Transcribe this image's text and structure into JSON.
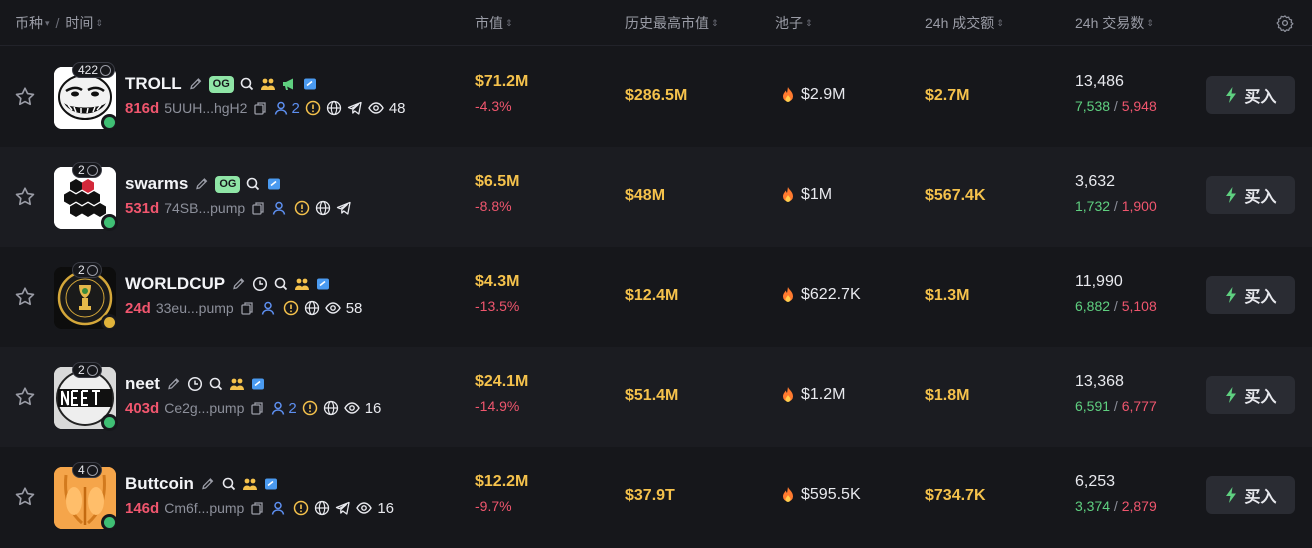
{
  "header": {
    "col_token": "币种",
    "col_time": "时间",
    "col_mcap": "市值",
    "col_ath": "历史最高市值",
    "col_pool": "池子",
    "col_vol": "24h 成交额",
    "col_txs": "24h 交易数"
  },
  "rows": [
    {
      "name": "TROLL",
      "holders_count": "422",
      "og": "OG",
      "age": "816d",
      "address": "5UUH...hgH2",
      "holders": "2",
      "watchers": "48",
      "market_cap": "$71.2M",
      "market_cap_change": "-4.3%",
      "ath": "$286.5M",
      "pool": "$2.9M",
      "volume": "$2.7M",
      "txs": "13,486",
      "buys": "7,538",
      "sells": "5,948",
      "buy_label": "买入",
      "avatar_color": "#ffffff"
    },
    {
      "name": "swarms",
      "holders_count": "2",
      "og": "OG",
      "age": "531d",
      "address": "74SB...pump",
      "holders": "",
      "watchers": "",
      "market_cap": "$6.5M",
      "market_cap_change": "-8.8%",
      "ath": "$48M",
      "pool": "$1M",
      "volume": "$567.4K",
      "txs": "3,632",
      "buys": "1,732",
      "sells": "1,900",
      "buy_label": "买入",
      "avatar_color": "#ffffff"
    },
    {
      "name": "WORLDCUP",
      "holders_count": "2",
      "og": "",
      "age": "24d",
      "address": "33eu...pump",
      "holders": "",
      "watchers": "58",
      "market_cap": "$4.3M",
      "market_cap_change": "-13.5%",
      "ath": "$12.4M",
      "pool": "$622.7K",
      "volume": "$1.3M",
      "txs": "11,990",
      "buys": "6,882",
      "sells": "5,108",
      "buy_label": "买入",
      "avatar_color": "#0d0d0d"
    },
    {
      "name": "neet",
      "holders_count": "2",
      "og": "",
      "age": "403d",
      "address": "Ce2g...pump",
      "holders": "2",
      "watchers": "16",
      "market_cap": "$24.1M",
      "market_cap_change": "-14.9%",
      "ath": "$51.4M",
      "pool": "$1.2M",
      "volume": "$1.8M",
      "txs": "13,368",
      "buys": "6,591",
      "sells": "6,777",
      "buy_label": "买入",
      "avatar_color": "#d9d9d9"
    },
    {
      "name": "Buttcoin",
      "holders_count": "4",
      "og": "",
      "age": "146d",
      "address": "Cm6f...pump",
      "holders": "",
      "watchers": "16",
      "market_cap": "$12.2M",
      "market_cap_change": "-9.7%",
      "ath": "$37.9T",
      "pool": "$595.5K",
      "volume": "$734.7K",
      "txs": "6,253",
      "buys": "3,374",
      "sells": "2,879",
      "buy_label": "买入",
      "avatar_color": "#f5a54a"
    }
  ],
  "colors": {
    "accent_gold": "#f5c24c",
    "negative": "#f0566e",
    "positive": "#5fd080",
    "holders_blue": "#5d8ff0"
  }
}
